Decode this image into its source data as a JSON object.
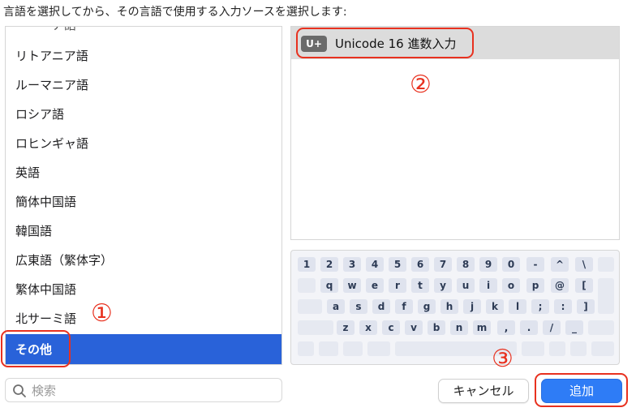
{
  "instruction": "言語を選択してから、その言語で使用する入力ソースを選択します:",
  "language_list": {
    "items": [
      "リトアニア語",
      "ルーマニア語",
      "ロシア語",
      "ロヒンギャ語",
      "英語",
      "簡体中国語",
      "韓国語",
      "広東語（繁体字）",
      "繁体中国語",
      "北サーミ語",
      "その他"
    ],
    "selected": "その他",
    "selection_color": "#2962d9"
  },
  "search": {
    "placeholder": "検索",
    "icon": "magnifier-icon"
  },
  "input_sources": {
    "items": [
      {
        "badge": "U+",
        "label": "Unicode 16 進数入力"
      }
    ]
  },
  "keyboard": {
    "rows": [
      [
        "1",
        "2",
        "3",
        "4",
        "5",
        "6",
        "7",
        "8",
        "9",
        "0",
        "-",
        "^",
        "\\"
      ],
      [
        "q",
        "w",
        "e",
        "r",
        "t",
        "y",
        "u",
        "i",
        "o",
        "p",
        "@",
        "["
      ],
      [
        "a",
        "s",
        "d",
        "f",
        "g",
        "h",
        "j",
        "k",
        "l",
        ";",
        ":",
        "]"
      ],
      [
        "z",
        "x",
        "c",
        "v",
        "b",
        "n",
        "m",
        ",",
        ".",
        "/",
        "_"
      ]
    ]
  },
  "buttons": {
    "cancel": "キャンセル",
    "add": "追加",
    "accent": "#2e7cf6"
  },
  "annotations": {
    "one": "①",
    "two": "②",
    "three": "③",
    "color": "#e8311f"
  }
}
